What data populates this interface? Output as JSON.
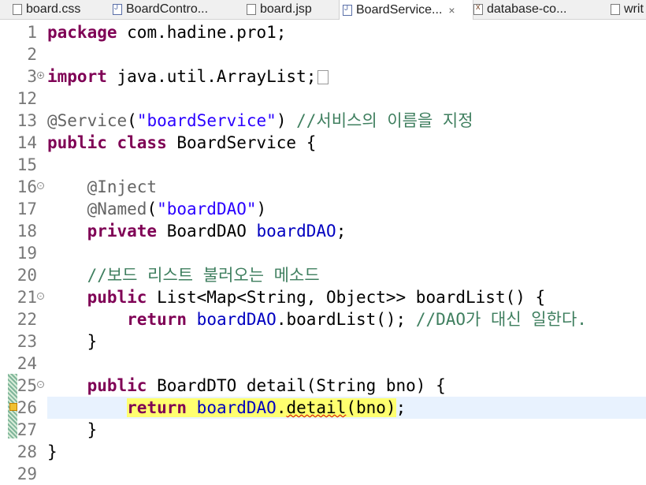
{
  "tabs": [
    {
      "label": "board.css",
      "icon": "css-file-icon",
      "active": false
    },
    {
      "label": "BoardContro...",
      "icon": "java-file-icon",
      "active": false
    },
    {
      "label": "board.jsp",
      "icon": "jsp-file-icon",
      "active": false
    },
    {
      "label": "BoardService...",
      "icon": "java-file-icon",
      "active": true,
      "close": "×"
    },
    {
      "label": "database-co...",
      "icon": "xml-file-icon",
      "active": false
    },
    {
      "label": "writ",
      "icon": "file-icon",
      "active": false
    }
  ],
  "editor": {
    "lines": [
      {
        "num": "1",
        "code": "package com.hadine.pro1;"
      },
      {
        "num": "2",
        "code": ""
      },
      {
        "num": "3",
        "code": "import java.util.ArrayList;",
        "fold": "+"
      },
      {
        "num": "12",
        "code": ""
      },
      {
        "num": "13",
        "code": "@Service(\"boardService\") //서비스의 이름을 지정"
      },
      {
        "num": "14",
        "code": "public class BoardService {"
      },
      {
        "num": "15",
        "code": ""
      },
      {
        "num": "16",
        "code": "    @Inject",
        "fold": "-"
      },
      {
        "num": "17",
        "code": "    @Named(\"boardDAO\")"
      },
      {
        "num": "18",
        "code": "    private BoardDAO boardDAO;"
      },
      {
        "num": "19",
        "code": ""
      },
      {
        "num": "20",
        "code": "    //보드 리스트 불러오는 메소드"
      },
      {
        "num": "21",
        "code": "    public List<Map<String, Object>> boardList() {",
        "fold": "-"
      },
      {
        "num": "22",
        "code": "        return boardDAO.boardList(); //DAO가 대신 일한다."
      },
      {
        "num": "23",
        "code": "    }"
      },
      {
        "num": "24",
        "code": ""
      },
      {
        "num": "25",
        "code": "    public BoardDTO detail(String bno) {",
        "fold": "-"
      },
      {
        "num": "26",
        "code": "        return boardDAO.detail(bno);"
      },
      {
        "num": "27",
        "code": "    }"
      },
      {
        "num": "28",
        "code": "}"
      },
      {
        "num": "29",
        "code": ""
      }
    ]
  },
  "colors": {
    "keyword": "#7f0055",
    "annotation": "#646464",
    "string": "#2a00ff",
    "comment": "#3f7f5f",
    "field": "#0000c0",
    "current_line": "#e8f2fe",
    "occurrence_highlight": "#ffff6f"
  }
}
